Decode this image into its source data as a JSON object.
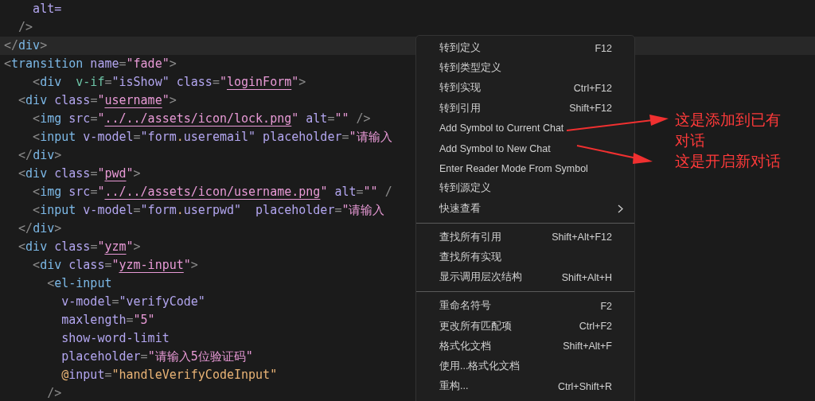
{
  "editor": {
    "lines": [
      {
        "current": false,
        "tokens": [
          {
            "kind": "attr",
            "t": "    alt="
          }
        ]
      },
      {
        "current": false,
        "tokens": [
          {
            "kind": "punct",
            "t": "  />"
          }
        ]
      },
      {
        "current": true,
        "tokens": [
          {
            "kind": "punct",
            "t": "</"
          },
          {
            "kind": "tag",
            "t": "div"
          },
          {
            "kind": "punct",
            "t": ">"
          }
        ]
      },
      {
        "current": false,
        "tokens": [
          {
            "kind": "punct",
            "t": "<"
          },
          {
            "kind": "tag",
            "t": "transition"
          },
          {
            "kind": "attr",
            "t": " name"
          },
          {
            "kind": "punct",
            "t": "="
          },
          {
            "kind": "string",
            "t": "\"fade\""
          },
          {
            "kind": "punct",
            "t": ">"
          }
        ]
      },
      {
        "current": false,
        "tokens": [
          {
            "kind": "punct",
            "t": "    <"
          },
          {
            "kind": "tag",
            "t": "div"
          },
          {
            "kind": "directive",
            "t": "  v-if"
          },
          {
            "kind": "punct",
            "t": "="
          },
          {
            "kind": "attr",
            "t": "\"isShow\""
          },
          {
            "kind": "attr",
            "t": " class"
          },
          {
            "kind": "punct",
            "t": "="
          },
          {
            "kind": "string",
            "t": "\""
          },
          {
            "kind": "link",
            "t": "loginForm"
          },
          {
            "kind": "string",
            "t": "\""
          },
          {
            "kind": "punct",
            "t": ">"
          }
        ]
      },
      {
        "current": false,
        "tokens": [
          {
            "kind": "punct",
            "t": "  <"
          },
          {
            "kind": "tag",
            "t": "div"
          },
          {
            "kind": "attr",
            "t": " class"
          },
          {
            "kind": "punct",
            "t": "="
          },
          {
            "kind": "string",
            "t": "\""
          },
          {
            "kind": "link",
            "t": "username"
          },
          {
            "kind": "string",
            "t": "\""
          },
          {
            "kind": "punct",
            "t": ">"
          }
        ]
      },
      {
        "current": false,
        "tokens": [
          {
            "kind": "punct",
            "t": "    <"
          },
          {
            "kind": "tag",
            "t": "img"
          },
          {
            "kind": "attr",
            "t": " src"
          },
          {
            "kind": "punct",
            "t": "="
          },
          {
            "kind": "string",
            "t": "\""
          },
          {
            "kind": "link",
            "t": "../../assets/icon/lock.png"
          },
          {
            "kind": "string",
            "t": "\""
          },
          {
            "kind": "attr",
            "t": " alt"
          },
          {
            "kind": "punct",
            "t": "="
          },
          {
            "kind": "string",
            "t": "\"\""
          },
          {
            "kind": "punct",
            "t": " />"
          }
        ]
      },
      {
        "current": false,
        "tokens": [
          {
            "kind": "punct",
            "t": "    <"
          },
          {
            "kind": "tag",
            "t": "input"
          },
          {
            "kind": "attr",
            "t": " v-model"
          },
          {
            "kind": "punct",
            "t": "="
          },
          {
            "kind": "attr",
            "t": "\"form"
          },
          {
            "kind": "event",
            "t": "."
          },
          {
            "kind": "attr",
            "t": "useremail\""
          },
          {
            "kind": "attr",
            "t": " placeholder"
          },
          {
            "kind": "punct",
            "t": "="
          },
          {
            "kind": "string",
            "t": "\"请输入"
          }
        ]
      },
      {
        "current": false,
        "tokens": [
          {
            "kind": "punct",
            "t": "  </"
          },
          {
            "kind": "tag",
            "t": "div"
          },
          {
            "kind": "punct",
            "t": ">"
          }
        ]
      },
      {
        "current": false,
        "tokens": [
          {
            "kind": "punct",
            "t": "  <"
          },
          {
            "kind": "tag",
            "t": "div"
          },
          {
            "kind": "attr",
            "t": " class"
          },
          {
            "kind": "punct",
            "t": "="
          },
          {
            "kind": "string",
            "t": "\""
          },
          {
            "kind": "link",
            "t": "pwd"
          },
          {
            "kind": "string",
            "t": "\""
          },
          {
            "kind": "punct",
            "t": ">"
          }
        ]
      },
      {
        "current": false,
        "tokens": [
          {
            "kind": "punct",
            "t": "    <"
          },
          {
            "kind": "tag",
            "t": "img"
          },
          {
            "kind": "attr",
            "t": " src"
          },
          {
            "kind": "punct",
            "t": "="
          },
          {
            "kind": "string",
            "t": "\""
          },
          {
            "kind": "link",
            "t": "../../assets/icon/username.png"
          },
          {
            "kind": "string",
            "t": "\""
          },
          {
            "kind": "attr",
            "t": " alt"
          },
          {
            "kind": "punct",
            "t": "="
          },
          {
            "kind": "string",
            "t": "\"\""
          },
          {
            "kind": "punct",
            "t": " /"
          }
        ]
      },
      {
        "current": false,
        "tokens": [
          {
            "kind": "punct",
            "t": "    <"
          },
          {
            "kind": "tag",
            "t": "input"
          },
          {
            "kind": "attr",
            "t": " v-model"
          },
          {
            "kind": "punct",
            "t": "="
          },
          {
            "kind": "attr",
            "t": "\"form"
          },
          {
            "kind": "event",
            "t": "."
          },
          {
            "kind": "attr",
            "t": "userpwd\""
          },
          {
            "kind": "attr",
            "t": "  placeholder"
          },
          {
            "kind": "punct",
            "t": "="
          },
          {
            "kind": "string",
            "t": "\"请输入"
          }
        ]
      },
      {
        "current": false,
        "tokens": [
          {
            "kind": "punct",
            "t": "  </"
          },
          {
            "kind": "tag",
            "t": "div"
          },
          {
            "kind": "punct",
            "t": ">"
          }
        ]
      },
      {
        "current": false,
        "tokens": [
          {
            "kind": "punct",
            "t": "  <"
          },
          {
            "kind": "tag",
            "t": "div"
          },
          {
            "kind": "attr",
            "t": " class"
          },
          {
            "kind": "punct",
            "t": "="
          },
          {
            "kind": "string",
            "t": "\""
          },
          {
            "kind": "link",
            "t": "yzm"
          },
          {
            "kind": "string",
            "t": "\""
          },
          {
            "kind": "punct",
            "t": ">"
          }
        ]
      },
      {
        "current": false,
        "tokens": [
          {
            "kind": "punct",
            "t": "    <"
          },
          {
            "kind": "tag",
            "t": "div"
          },
          {
            "kind": "attr",
            "t": " class"
          },
          {
            "kind": "punct",
            "t": "="
          },
          {
            "kind": "string",
            "t": "\""
          },
          {
            "kind": "link",
            "t": "yzm-input"
          },
          {
            "kind": "string",
            "t": "\""
          },
          {
            "kind": "punct",
            "t": ">"
          }
        ]
      },
      {
        "current": false,
        "tokens": [
          {
            "kind": "punct",
            "t": "      <"
          },
          {
            "kind": "tag",
            "t": "el-input"
          }
        ]
      },
      {
        "current": false,
        "tokens": [
          {
            "kind": "attr",
            "t": "        v-model"
          },
          {
            "kind": "punct",
            "t": "="
          },
          {
            "kind": "attr",
            "t": "\"verifyCode\""
          }
        ]
      },
      {
        "current": false,
        "tokens": [
          {
            "kind": "attr",
            "t": "        maxlength"
          },
          {
            "kind": "punct",
            "t": "="
          },
          {
            "kind": "string",
            "t": "\"5\""
          }
        ]
      },
      {
        "current": false,
        "tokens": [
          {
            "kind": "attr",
            "t": "        show-word-limit"
          }
        ]
      },
      {
        "current": false,
        "tokens": [
          {
            "kind": "attr",
            "t": "        placeholder"
          },
          {
            "kind": "punct",
            "t": "="
          },
          {
            "kind": "string",
            "t": "\"请输入5位验证码\""
          }
        ]
      },
      {
        "current": false,
        "tokens": [
          {
            "kind": "event",
            "t": "        @"
          },
          {
            "kind": "attr",
            "t": "input"
          },
          {
            "kind": "punct",
            "t": "="
          },
          {
            "kind": "event",
            "t": "\"handleVerifyCodeInput\""
          }
        ]
      },
      {
        "current": false,
        "tokens": [
          {
            "kind": "punct",
            "t": "      />"
          }
        ]
      }
    ]
  },
  "context_menu": [
    {
      "kind": "item",
      "label": "转到定义",
      "shortcut": "F12"
    },
    {
      "kind": "item",
      "label": "转到类型定义"
    },
    {
      "kind": "item",
      "label": "转到实现",
      "shortcut": "Ctrl+F12"
    },
    {
      "kind": "item",
      "label": "转到引用",
      "shortcut": "Shift+F12"
    },
    {
      "kind": "item",
      "label": "Add Symbol to Current Chat"
    },
    {
      "kind": "item",
      "label": "Add Symbol to New Chat"
    },
    {
      "kind": "item",
      "label": "Enter Reader Mode From Symbol"
    },
    {
      "kind": "item",
      "label": "转到源定义"
    },
    {
      "kind": "submenu",
      "label": "快速查看"
    },
    {
      "kind": "separator"
    },
    {
      "kind": "item",
      "label": "查找所有引用",
      "shortcut": "Shift+Alt+F12"
    },
    {
      "kind": "item",
      "label": "查找所有实现"
    },
    {
      "kind": "item",
      "label": "显示调用层次结构",
      "shortcut": "Shift+Alt+H"
    },
    {
      "kind": "separator"
    },
    {
      "kind": "item",
      "label": "重命名符号",
      "shortcut": "F2"
    },
    {
      "kind": "item",
      "label": "更改所有匹配项",
      "shortcut": "Ctrl+F2"
    },
    {
      "kind": "item",
      "label": "格式化文档",
      "shortcut": "Shift+Alt+F"
    },
    {
      "kind": "item",
      "label": "使用...格式化文档"
    },
    {
      "kind": "item",
      "label": "重构...",
      "shortcut": "Ctrl+Shift+R"
    }
  ],
  "annotations": [
    {
      "text": "这是添加到已有对话"
    },
    {
      "text": "这是开启新对话"
    }
  ]
}
